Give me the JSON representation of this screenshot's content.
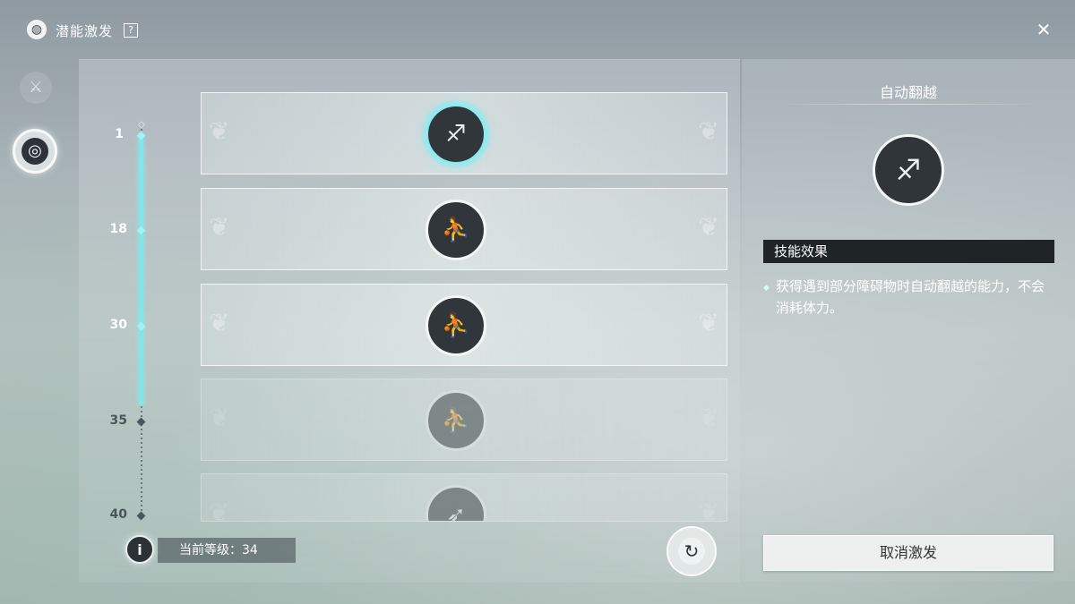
{
  "header": {
    "title": "潜能激发",
    "help_icon": "?",
    "close_icon": "close-cross-icon"
  },
  "nav": {
    "items": [
      {
        "icon": "crossed-swords-shield-icon",
        "glyph": "⚔",
        "active": false
      },
      {
        "icon": "spiral-vortex-icon",
        "glyph": "◎",
        "active": true
      }
    ]
  },
  "levels": [
    {
      "label": "1",
      "reached": true
    },
    {
      "label": "18",
      "reached": true
    },
    {
      "label": "30",
      "reached": true
    },
    {
      "label": "35",
      "reached": false
    },
    {
      "label": "40",
      "reached": false
    }
  ],
  "rows": [
    {
      "icon": "vault-jump-icon",
      "glyph": "♐",
      "state": "selected"
    },
    {
      "icon": "climb-run-icon",
      "glyph": "⛹",
      "state": "unlocked"
    },
    {
      "icon": "climb-run-icon",
      "glyph": "⛹",
      "state": "unlocked"
    },
    {
      "icon": "climb-run-icon",
      "glyph": "⛹",
      "state": "locked"
    },
    {
      "icon": "glide-icon",
      "glyph": "➶",
      "state": "locked"
    }
  ],
  "footer": {
    "info_icon": "i",
    "current_level_text": "当前等级：34",
    "current_level": 34,
    "reset_icon": "↻"
  },
  "detail": {
    "skill_name": "自动翻越",
    "skill_glyph": "♐",
    "effect_heading": "技能效果",
    "effect_text": "获得遇到部分障碍物时自动翻越的能力，不会消耗体力。",
    "cancel_label": "取消激发"
  },
  "colors": {
    "track_active": "#7fe6ee",
    "panel_dark": "#1f2427"
  }
}
